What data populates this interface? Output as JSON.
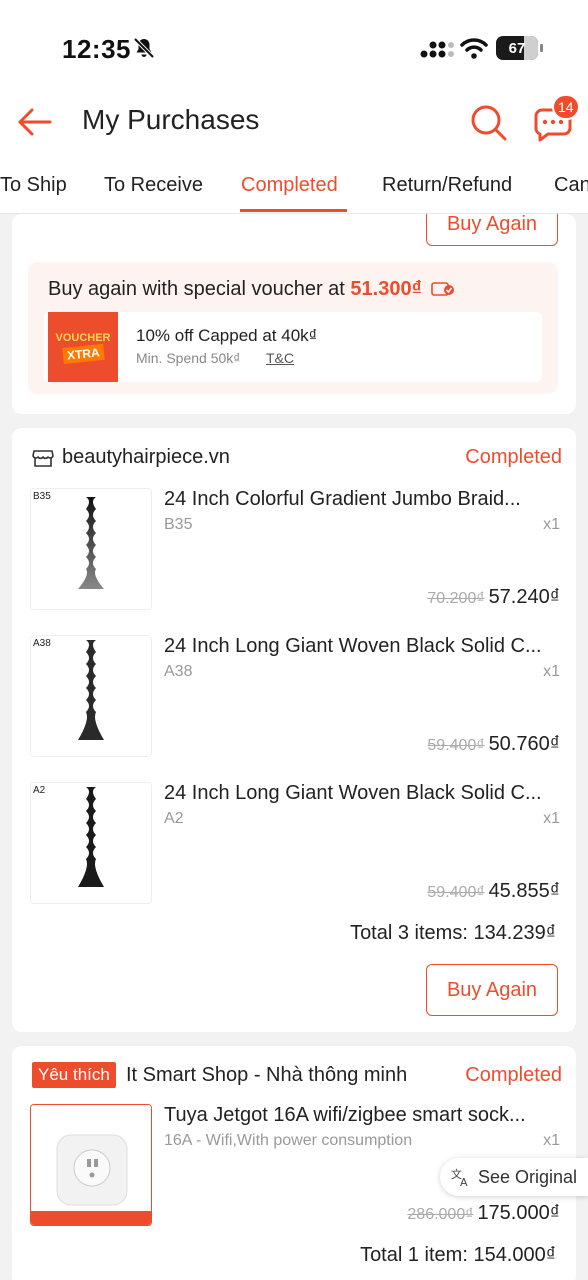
{
  "status_bar": {
    "time": "12:35",
    "battery": "67"
  },
  "header": {
    "title": "My Purchases",
    "chat_badge": "14"
  },
  "tabs": [
    {
      "label": "To Ship"
    },
    {
      "label": "To Receive"
    },
    {
      "label": "Completed"
    },
    {
      "label": "Return/Refund"
    },
    {
      "label": "Can"
    }
  ],
  "card_top": {
    "buy_again": "Buy Again",
    "voucher_prompt": "Buy again with special voucher at ",
    "voucher_price": "51.300₫",
    "voucher_img_line1": "VOUCHER",
    "voucher_img_line2": "XTRA",
    "voucher_title": "10% off Capped at 40k₫",
    "voucher_min": "Min. Spend 50k₫",
    "voucher_tc": "T&C"
  },
  "order1": {
    "shop": "beautyhairpiece.vn",
    "status": "Completed",
    "items": [
      {
        "thumb_label": "B35",
        "name": "24 Inch Colorful Gradient Jumbo Braid...",
        "variation": "B35",
        "qty": "x1",
        "old_price": "70.200₫",
        "price": "57.240₫"
      },
      {
        "thumb_label": "A38",
        "name": "24 Inch Long Giant Woven Black Solid C...",
        "variation": "A38",
        "qty": "x1",
        "old_price": "59.400₫",
        "price": "50.760₫"
      },
      {
        "thumb_label": "A2",
        "name": "24 Inch Long Giant Woven Black Solid C...",
        "variation": "A2",
        "qty": "x1",
        "old_price": "59.400₫",
        "price": "45.855₫"
      }
    ],
    "total": "Total 3 items: 134.239₫",
    "buy_again": "Buy Again"
  },
  "order2": {
    "fav_badge": "Yêu thích",
    "shop": "It Smart Shop - Nhà thông minh",
    "status": "Completed",
    "item": {
      "name": "Tuya Jetgot 16A wifi/zigbee smart sock...",
      "variation": "16A - Wifi,With power consumption",
      "qty": "x1",
      "old_price": "286.000₫",
      "price": "175.000₫"
    },
    "total": "Total 1 item: 154.000₫"
  },
  "see_original": "See Original",
  "colors": {
    "accent": "#ee4d2d"
  }
}
